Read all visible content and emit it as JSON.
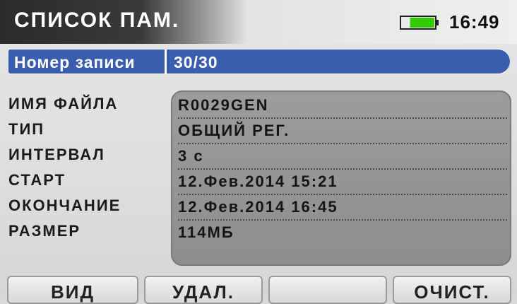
{
  "header": {
    "title": "СПИСОК ПАМ.",
    "battery_icon": "battery-icon",
    "battery_level": 0.75,
    "time": "16:49"
  },
  "record": {
    "label": "Номер записи",
    "value": "30/30"
  },
  "fields": [
    {
      "label": "ИМЯ ФАЙЛА",
      "value": "R0029GEN"
    },
    {
      "label": "ТИП",
      "value": "ОБЩИЙ РЕГ."
    },
    {
      "label": "ИНТЕРВАЛ",
      "value": "3 с"
    },
    {
      "label": "СТАРТ",
      "value": "12.Фев.2014 15:21"
    },
    {
      "label": "ОКОНЧАНИЕ",
      "value": "12.Фев.2014 16:45"
    },
    {
      "label": "РАЗМЕР",
      "value": "114МБ"
    }
  ],
  "softkeys": {
    "f1": "ВИД",
    "f2": "УДАЛ.",
    "f3": "",
    "f4": "ОЧИСТ."
  },
  "colors": {
    "highlight": "#3a5dae",
    "battery": "#33cc00"
  }
}
